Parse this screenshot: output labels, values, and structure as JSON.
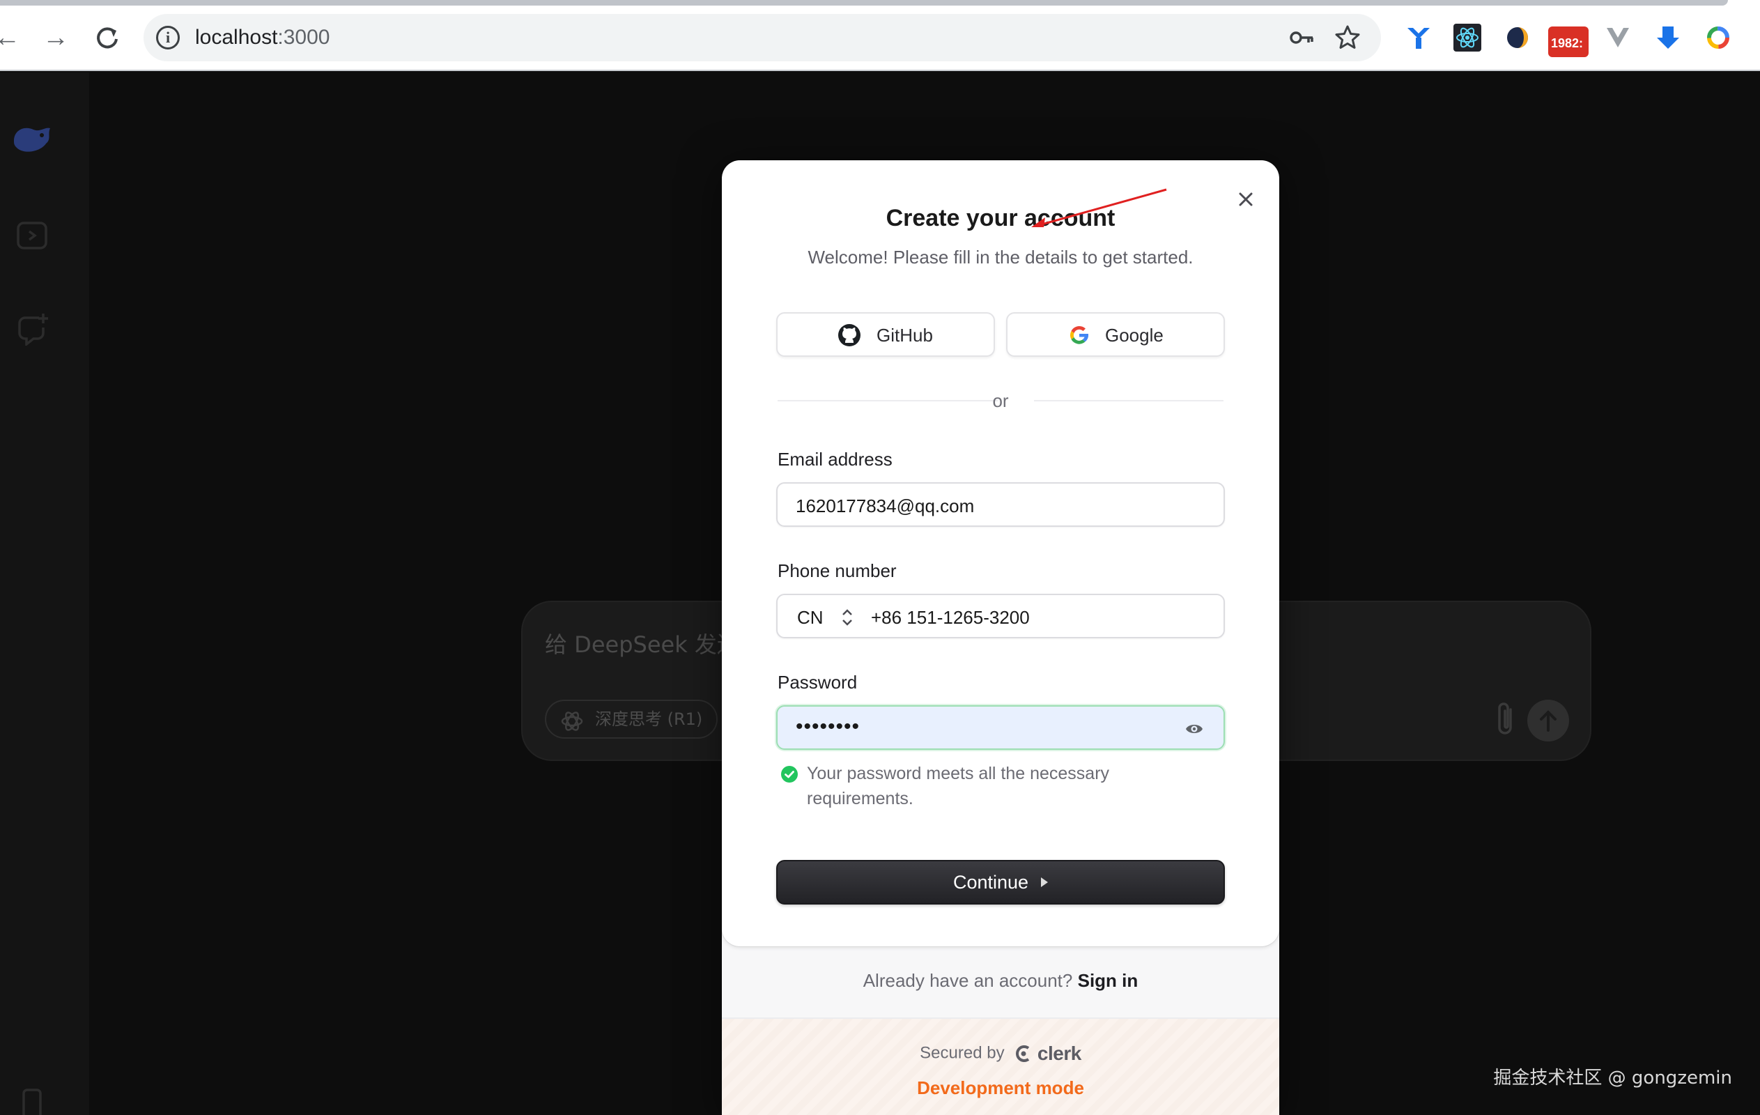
{
  "browser": {
    "url_host": "localhost",
    "url_port": ":3000",
    "extensions": [
      "y-ext-icon",
      "react-devtools-icon",
      "ext-half-moon-icon",
      "ext-1982-icon",
      "vue-devtools-icon",
      "ext-arrow-down-icon",
      "ext-color-ring-icon"
    ],
    "ext_1982_label": "1982:"
  },
  "background_app": {
    "composer_placeholder": "给 DeepSeek 发送",
    "deep_think_label": "深度思考 (R1)"
  },
  "modal": {
    "title": "Create your account",
    "subtitle": "Welcome! Please fill in the details to get started.",
    "github_label": "GitHub",
    "google_label": "Google",
    "divider_text": "or",
    "email_label": "Email address",
    "email_value": "1620177834@qq.com",
    "phone_label": "Phone number",
    "phone_country": "CN",
    "phone_value": "+86 151-1265-3200",
    "password_label": "Password",
    "password_value": "••••••••",
    "password_ok_text": "Your password meets all the necessary requirements.",
    "continue_label": "Continue",
    "have_account_text": "Already have an account?",
    "signin_link": "Sign in",
    "secured_by": "Secured by",
    "clerk_name": "clerk",
    "dev_mode": "Development mode"
  },
  "watermark": "掘金技术社区 @ gongzemin",
  "colors": {
    "accent_dev": "#f26a1b",
    "success": "#22c55e",
    "annotation_arrow": "#e02020"
  }
}
